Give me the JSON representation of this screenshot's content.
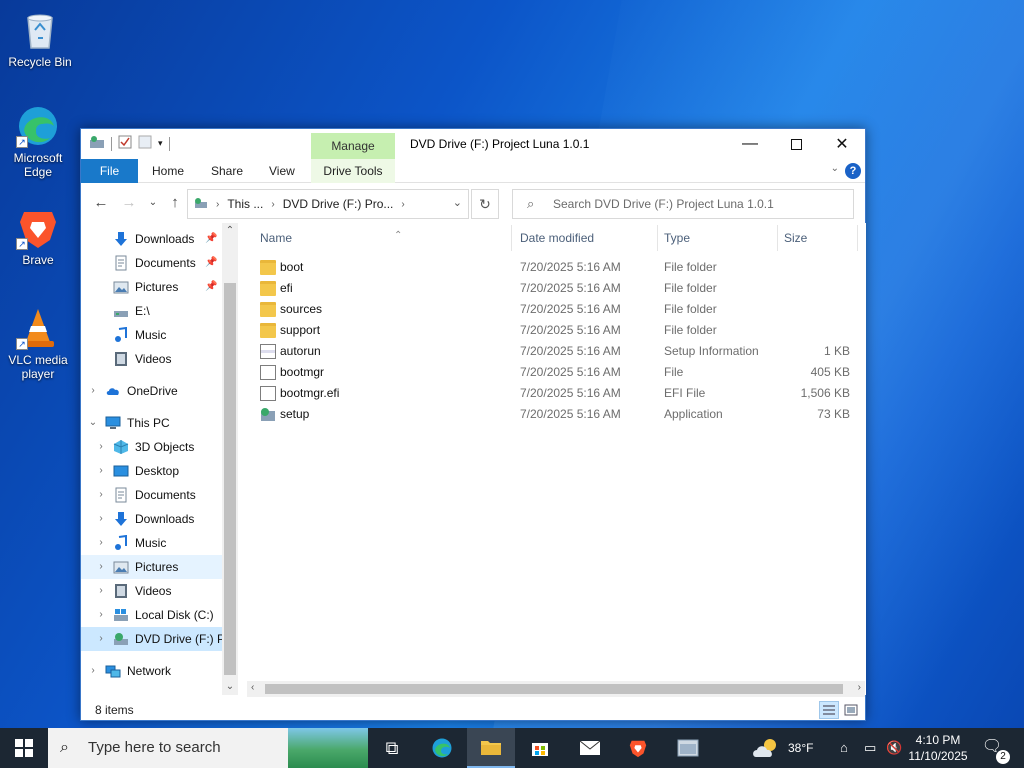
{
  "desktop": {
    "icons": [
      {
        "label": "Recycle Bin"
      },
      {
        "label": "Microsoft Edge"
      },
      {
        "label": "Brave"
      },
      {
        "label": "VLC media player"
      }
    ]
  },
  "window": {
    "title": "DVD Drive (F:) Project Luna 1.0.1",
    "manage_tab": "Manage",
    "ribbon_tabs": {
      "file": "File",
      "home": "Home",
      "share": "Share",
      "view": "View",
      "drive_tools": "Drive Tools"
    },
    "address": {
      "crumb1": "This ...",
      "crumb2": "DVD Drive (F:) Pro..."
    },
    "search": {
      "placeholder": "Search DVD Drive (F:) Project Luna 1.0.1"
    },
    "nav": {
      "quick": [
        {
          "label": "Downloads",
          "pinned": true
        },
        {
          "label": "Documents",
          "pinned": true
        },
        {
          "label": "Pictures",
          "pinned": true
        },
        {
          "label": "E:\\",
          "pinned": false
        },
        {
          "label": "Music",
          "pinned": false
        },
        {
          "label": "Videos",
          "pinned": false
        }
      ],
      "onedrive": "OneDrive",
      "thispc": "This PC",
      "pc_items": [
        {
          "label": "3D Objects"
        },
        {
          "label": "Desktop"
        },
        {
          "label": "Documents"
        },
        {
          "label": "Downloads"
        },
        {
          "label": "Music"
        },
        {
          "label": "Pictures"
        },
        {
          "label": "Videos"
        },
        {
          "label": "Local Disk (C:)"
        },
        {
          "label": "DVD Drive (F:) Pr"
        }
      ],
      "network": "Network"
    },
    "columns": {
      "name": "Name",
      "date": "Date modified",
      "type": "Type",
      "size": "Size"
    },
    "files": [
      {
        "name": "boot",
        "date": "7/20/2025 5:16 AM",
        "type": "File folder",
        "size": "",
        "kind": "folder"
      },
      {
        "name": "efi",
        "date": "7/20/2025 5:16 AM",
        "type": "File folder",
        "size": "",
        "kind": "folder"
      },
      {
        "name": "sources",
        "date": "7/20/2025 5:16 AM",
        "type": "File folder",
        "size": "",
        "kind": "folder"
      },
      {
        "name": "support",
        "date": "7/20/2025 5:16 AM",
        "type": "File folder",
        "size": "",
        "kind": "folder"
      },
      {
        "name": "autorun",
        "date": "7/20/2025 5:16 AM",
        "type": "Setup Information",
        "size": "1 KB",
        "kind": "inf"
      },
      {
        "name": "bootmgr",
        "date": "7/20/2025 5:16 AM",
        "type": "File",
        "size": "405 KB",
        "kind": "file"
      },
      {
        "name": "bootmgr.efi",
        "date": "7/20/2025 5:16 AM",
        "type": "EFI File",
        "size": "1,506 KB",
        "kind": "file"
      },
      {
        "name": "setup",
        "date": "7/20/2025 5:16 AM",
        "type": "Application",
        "size": "73 KB",
        "kind": "app"
      }
    ],
    "status": {
      "count": "8 items"
    }
  },
  "taskbar": {
    "search_placeholder": "Type here to search",
    "weather": "38°F",
    "time": "4:10 PM",
    "date": "11/10/2025",
    "notification_count": "2"
  },
  "colors": {
    "accent": "#1979ca",
    "selection": "#cce8ff",
    "manage_green": "#c6efb0",
    "taskbar": "#1c2733"
  }
}
